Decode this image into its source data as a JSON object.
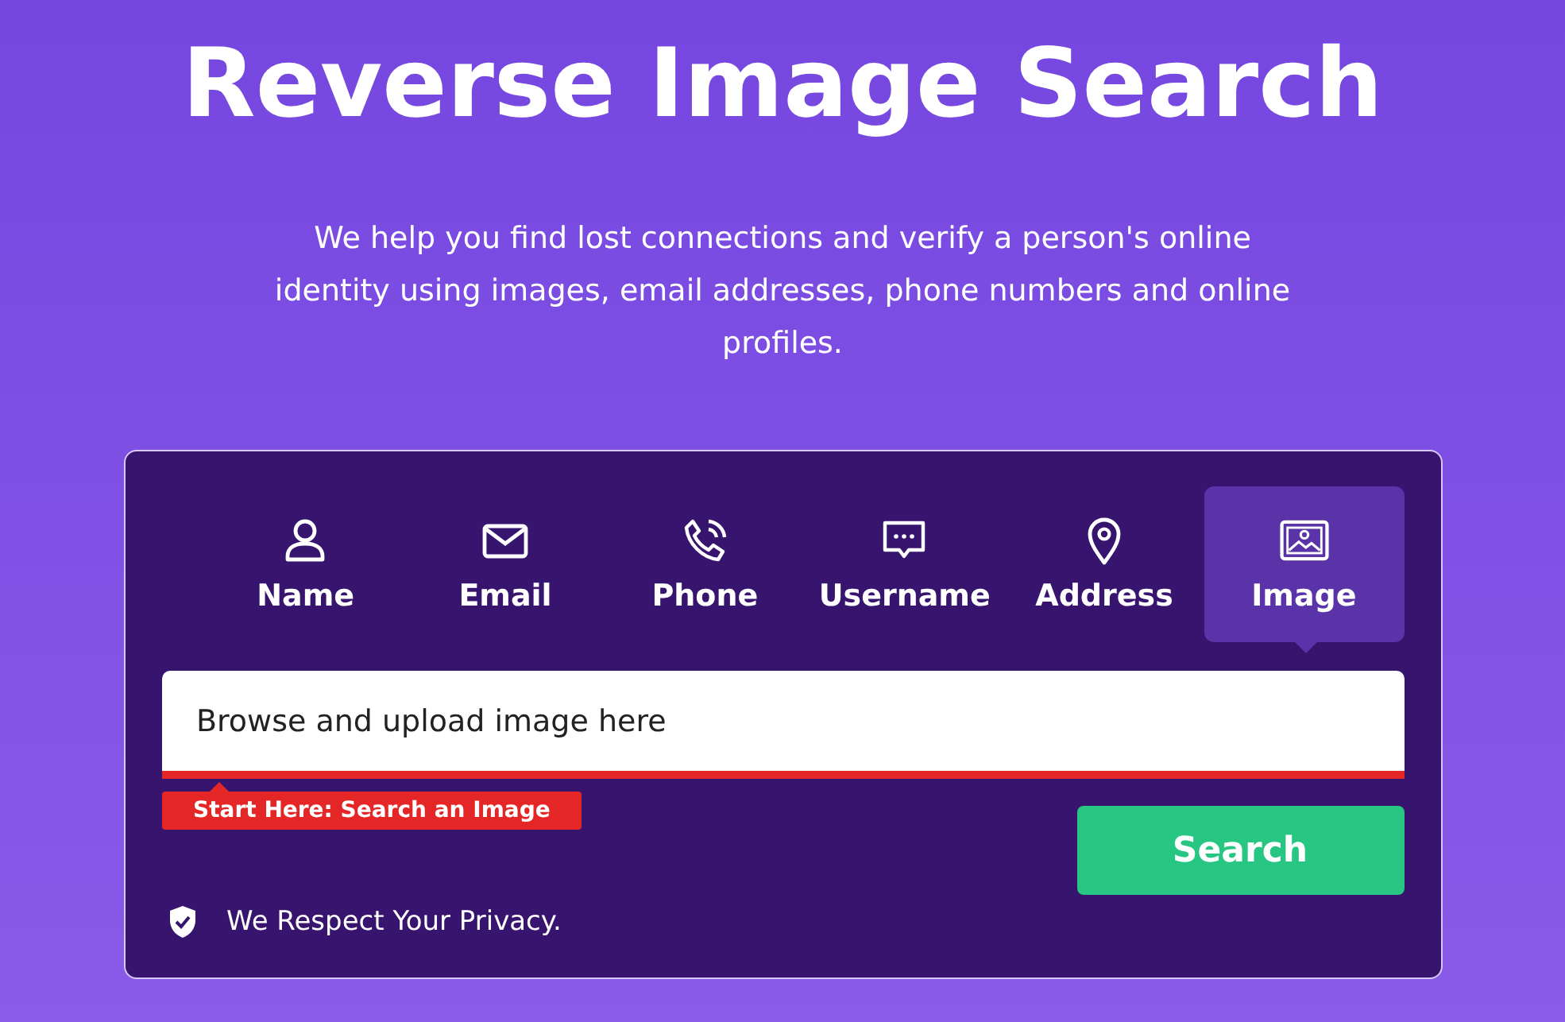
{
  "title": "Reverse Image Search",
  "subtitle": "We help you find lost connections and verify a person's online identity using images, email addresses, phone numbers and online profiles.",
  "tabs": [
    {
      "kind": "person",
      "label": "Name",
      "selected": false
    },
    {
      "kind": "mail",
      "label": "Email",
      "selected": false
    },
    {
      "kind": "phone",
      "label": "Phone",
      "selected": false
    },
    {
      "kind": "chat",
      "label": "Username",
      "selected": false
    },
    {
      "kind": "pin",
      "label": "Address",
      "selected": false
    },
    {
      "kind": "image",
      "label": "Image",
      "selected": true
    }
  ],
  "search": {
    "placeholder": "Browse and upload image here",
    "hint": "Start Here: Search an Image",
    "button": "Search"
  },
  "privacy": "We Respect Your Privacy."
}
